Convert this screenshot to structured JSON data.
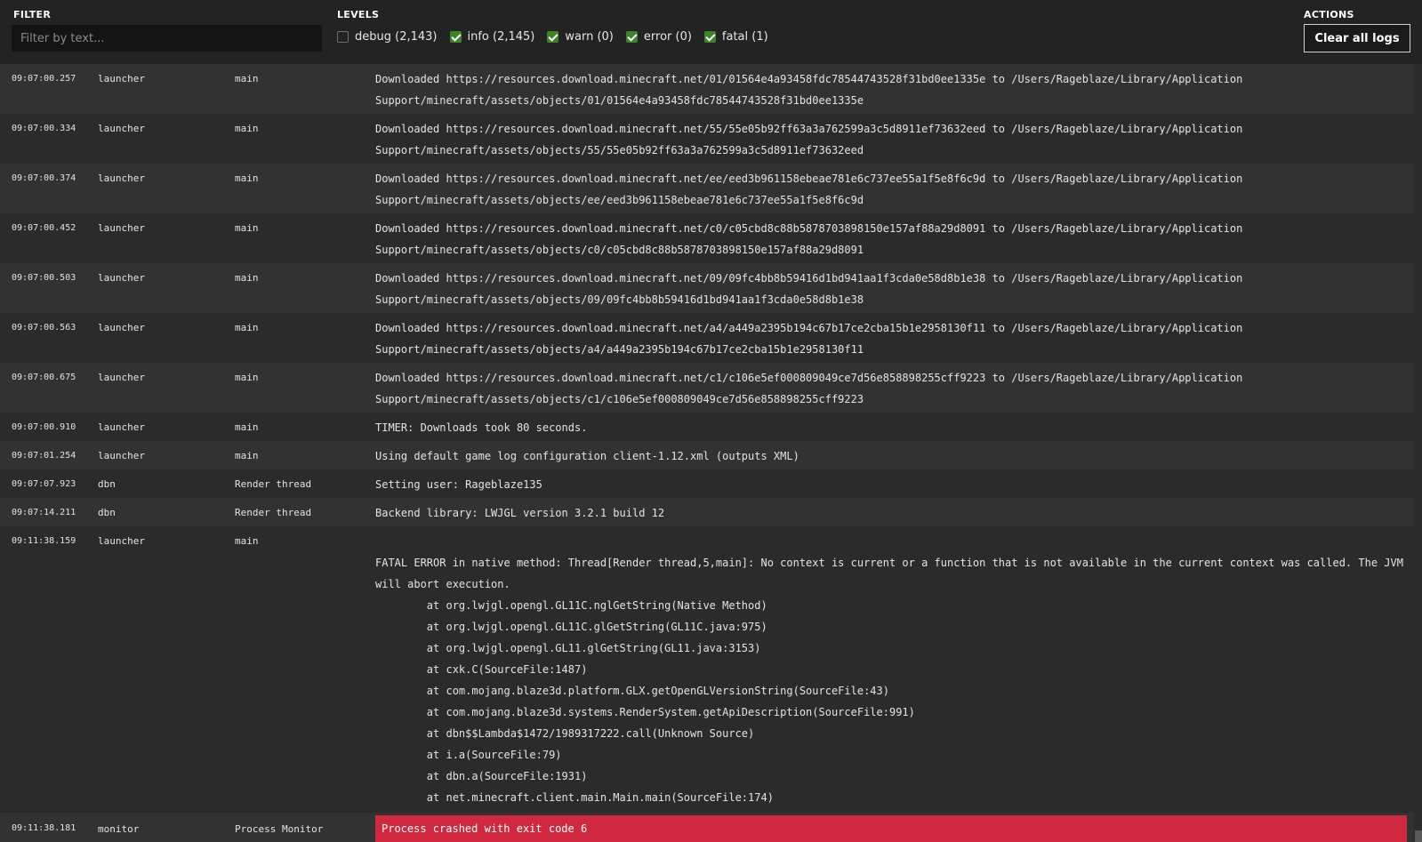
{
  "toolbar": {
    "filter_title": "FILTER",
    "filter_placeholder": "Filter by text...",
    "levels_title": "LEVELS",
    "actions_title": "ACTIONS",
    "clear_label": "Clear all logs",
    "levels": [
      {
        "label": "debug (2,143)",
        "checked": false
      },
      {
        "label": "info (2,145)",
        "checked": true
      },
      {
        "label": "warn (0)",
        "checked": true
      },
      {
        "label": "error (0)",
        "checked": true
      },
      {
        "label": "fatal (1)",
        "checked": true
      }
    ]
  },
  "colors": {
    "accent_green": "#3c8527",
    "crash_red": "#d0293f",
    "background": "#2b2b2b"
  },
  "logs": [
    {
      "time": "09:07:00.257",
      "source": "launcher",
      "thread": "main",
      "message": "Downloaded https://resources.download.minecraft.net/01/01564e4a93458fdc78544743528f31bd0ee1335e to /Users/Rageblaze/Library/Application\nSupport/minecraft/assets/objects/01/01564e4a93458fdc78544743528f31bd0ee1335e"
    },
    {
      "time": "09:07:00.334",
      "source": "launcher",
      "thread": "main",
      "message": "Downloaded https://resources.download.minecraft.net/55/55e05b92ff63a3a762599a3c5d8911ef73632eed to /Users/Rageblaze/Library/Application\nSupport/minecraft/assets/objects/55/55e05b92ff63a3a762599a3c5d8911ef73632eed"
    },
    {
      "time": "09:07:00.374",
      "source": "launcher",
      "thread": "main",
      "message": "Downloaded https://resources.download.minecraft.net/ee/eed3b961158ebeae781e6c737ee55a1f5e8f6c9d to /Users/Rageblaze/Library/Application\nSupport/minecraft/assets/objects/ee/eed3b961158ebeae781e6c737ee55a1f5e8f6c9d"
    },
    {
      "time": "09:07:00.452",
      "source": "launcher",
      "thread": "main",
      "message": "Downloaded https://resources.download.minecraft.net/c0/c05cbd8c88b5878703898150e157af88a29d8091 to /Users/Rageblaze/Library/Application\nSupport/minecraft/assets/objects/c0/c05cbd8c88b5878703898150e157af88a29d8091"
    },
    {
      "time": "09:07:00.503",
      "source": "launcher",
      "thread": "main",
      "message": "Downloaded https://resources.download.minecraft.net/09/09fc4bb8b59416d1bd941aa1f3cda0e58d8b1e38 to /Users/Rageblaze/Library/Application\nSupport/minecraft/assets/objects/09/09fc4bb8b59416d1bd941aa1f3cda0e58d8b1e38"
    },
    {
      "time": "09:07:00.563",
      "source": "launcher",
      "thread": "main",
      "message": "Downloaded https://resources.download.minecraft.net/a4/a449a2395b194c67b17ce2cba15b1e2958130f11 to /Users/Rageblaze/Library/Application\nSupport/minecraft/assets/objects/a4/a449a2395b194c67b17ce2cba15b1e2958130f11"
    },
    {
      "time": "09:07:00.675",
      "source": "launcher",
      "thread": "main",
      "message": "Downloaded https://resources.download.minecraft.net/c1/c106e5ef000809049ce7d56e858898255cff9223 to /Users/Rageblaze/Library/Application\nSupport/minecraft/assets/objects/c1/c106e5ef000809049ce7d56e858898255cff9223"
    },
    {
      "time": "09:07:00.910",
      "source": "launcher",
      "thread": "main",
      "message": "TIMER: Downloads took 80 seconds."
    },
    {
      "time": "09:07:01.254",
      "source": "launcher",
      "thread": "main",
      "message": "Using default game log configuration client-1.12.xml (outputs XML)"
    },
    {
      "time": "09:07:07.923",
      "source": "dbn",
      "thread": "Render thread",
      "message": "Setting user: Rageblaze135"
    },
    {
      "time": "09:07:14.211",
      "source": "dbn",
      "thread": "Render thread",
      "message": "Backend library: LWJGL version 3.2.1 build 12"
    },
    {
      "time": "09:11:38.159",
      "source": "launcher",
      "thread": "main",
      "message": "\nFATAL ERROR in native method: Thread[Render thread,5,main]: No context is current or a function that is not available in the current context was called. The JVM will abort execution.\n\tat org.lwjgl.opengl.GL11C.nglGetString(Native Method)\n\tat org.lwjgl.opengl.GL11C.glGetString(GL11C.java:975)\n\tat org.lwjgl.opengl.GL11.glGetString(GL11.java:3153)\n\tat cxk.C(SourceFile:1487)\n\tat com.mojang.blaze3d.platform.GLX.getOpenGLVersionString(SourceFile:43)\n\tat com.mojang.blaze3d.systems.RenderSystem.getApiDescription(SourceFile:991)\n\tat dbn$$Lambda$1472/1989317222.call(Unknown Source)\n\tat i.a(SourceFile:79)\n\tat dbn.a(SourceFile:1931)\n\tat net.minecraft.client.main.Main.main(SourceFile:174)"
    },
    {
      "time": "09:11:38.181",
      "source": "monitor",
      "thread": "Process Monitor",
      "message": "Process crashed with exit code 6"
    }
  ]
}
